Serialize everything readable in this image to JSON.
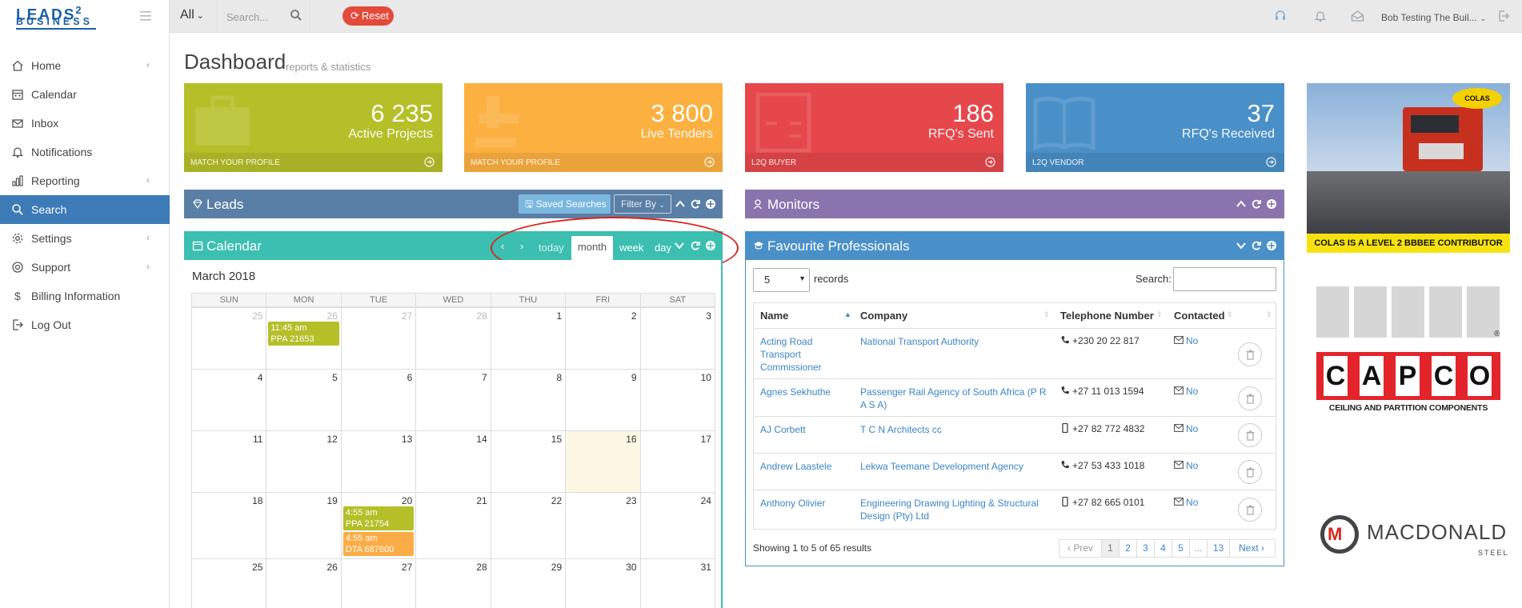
{
  "topbar": {
    "logo_line1": "LEADS",
    "logo_sup": "2",
    "logo_line2": "BUSINESS",
    "scope_select": "All",
    "search_placeholder": "Search...",
    "reset_label": "Reset",
    "user_name": "Bob Testing The Buil..."
  },
  "sidebar": {
    "items": [
      {
        "label": "Home",
        "icon": "home-icon",
        "arrow": true
      },
      {
        "label": "Calendar",
        "icon": "calendar-icon",
        "arrow": false
      },
      {
        "label": "Inbox",
        "icon": "inbox-icon",
        "arrow": false
      },
      {
        "label": "Notifications",
        "icon": "bell-icon",
        "arrow": false
      },
      {
        "label": "Reporting",
        "icon": "chart-icon",
        "arrow": true
      },
      {
        "label": "Search",
        "icon": "search-icon",
        "arrow": false,
        "active": true
      },
      {
        "label": "Settings",
        "icon": "gear-icon",
        "arrow": true
      },
      {
        "label": "Support",
        "icon": "lifebuoy-icon",
        "arrow": true
      },
      {
        "label": "Billing Information",
        "icon": "dollar-icon",
        "arrow": false
      },
      {
        "label": "Log Out",
        "icon": "logout-icon",
        "arrow": false
      }
    ]
  },
  "page": {
    "title": "Dashboard",
    "subtitle": "reports & statistics"
  },
  "stats": [
    {
      "value": "6 235",
      "label": "Active Projects",
      "footer": "MATCH YOUR PROFILE",
      "color": "#b5bf28"
    },
    {
      "value": "3 800",
      "label": "Live Tenders",
      "footer": "MATCH YOUR PROFILE",
      "color": "#fcb040"
    },
    {
      "value": "186",
      "label": "RFQ's Sent",
      "footer": "L2Q BUYER",
      "color": "#e5474b"
    },
    {
      "value": "37",
      "label": "RFQ's Received",
      "footer": "L2Q VENDOR",
      "color": "#4a90c8"
    }
  ],
  "leads_panel": {
    "title": "Leads",
    "saved_searches": "Saved Searches",
    "filter_by": "Filter By",
    "color": "#5a7fa6"
  },
  "monitors_panel": {
    "title": "Monitors",
    "color": "#8a74ae"
  },
  "calendar_panel": {
    "title": "Calendar",
    "color": "#3bbfb0",
    "nav": {
      "today": "today",
      "month": "month",
      "week": "week",
      "day": "day"
    },
    "month_title": "March 2018",
    "days_of_week": [
      "SUN",
      "MON",
      "TUE",
      "WED",
      "THU",
      "FRI",
      "SAT"
    ],
    "weeks": [
      [
        "25",
        "26",
        "27",
        "28",
        "1",
        "2",
        "3"
      ],
      [
        "4",
        "5",
        "6",
        "7",
        "8",
        "9",
        "10"
      ],
      [
        "11",
        "12",
        "13",
        "14",
        "15",
        "16",
        "17"
      ],
      [
        "18",
        "19",
        "20",
        "21",
        "22",
        "23",
        "24"
      ],
      [
        "25",
        "26",
        "27",
        "28",
        "29",
        "30",
        "31"
      ]
    ],
    "events": [
      {
        "week": 0,
        "day": 1,
        "time": "11:45 am",
        "title": "PPA 21653",
        "color": "green"
      },
      {
        "week": 3,
        "day": 2,
        "time": "4:55 am",
        "title": "PPA 21754",
        "color": "green"
      },
      {
        "week": 3,
        "day": 2,
        "time": "4:55 am",
        "title": "DTA 687600",
        "color": "orange"
      }
    ]
  },
  "favourites_panel": {
    "title": "Favourite Professionals",
    "color": "#4a90c8",
    "page_length": "5",
    "records_label": "records",
    "search_label": "Search:",
    "columns": [
      "Name",
      "Company",
      "Telephone Number",
      "Contacted"
    ],
    "rows": [
      {
        "name": "Acting Road Transport Commissioner",
        "company": "National Transport Authority",
        "phone": "+230 20 22 817",
        "phone_type": "phone-icon",
        "contacted": "No"
      },
      {
        "name": "Agnes Sekhuthe",
        "company": "Passenger Rail Agency of South Africa (P R A S A)",
        "phone": "+27 11 013 1594",
        "phone_type": "phone-icon",
        "contacted": "No"
      },
      {
        "name": "AJ Corbett",
        "company": "T C N Architects cc",
        "phone": "+27 82 772 4832",
        "phone_type": "mobile-icon",
        "contacted": "No"
      },
      {
        "name": "Andrew Laastele",
        "company": "Lekwa Teemane Development Agency",
        "phone": "+27 53 433 1018",
        "phone_type": "phone-icon",
        "contacted": "No"
      },
      {
        "name": "Anthony Olivier",
        "company": "Engineering Drawing Lighting & Structural Design (Pty) Ltd",
        "phone": "+27 82 665 0101",
        "phone_type": "mobile-icon",
        "contacted": "No"
      }
    ],
    "showing": "Showing 1 to 5 of 65 results",
    "pager": [
      "Prev",
      "1",
      "2",
      "3",
      "4",
      "5",
      "...",
      "13",
      "Next"
    ]
  },
  "ads": {
    "colas_badge": "COLAS",
    "colas_strip": "COLAS IS A LEVEL 2 BBBEE CONTRIBUTOR",
    "capco_letters": [
      "C",
      "A",
      "P",
      "C",
      "O"
    ],
    "capco_tag": "CEILING AND PARTITION COMPONENTS",
    "capco_reg": "®",
    "mac_word": "MACDONALD",
    "mac_steel": "STEEL",
    "mac_mark": "M"
  }
}
